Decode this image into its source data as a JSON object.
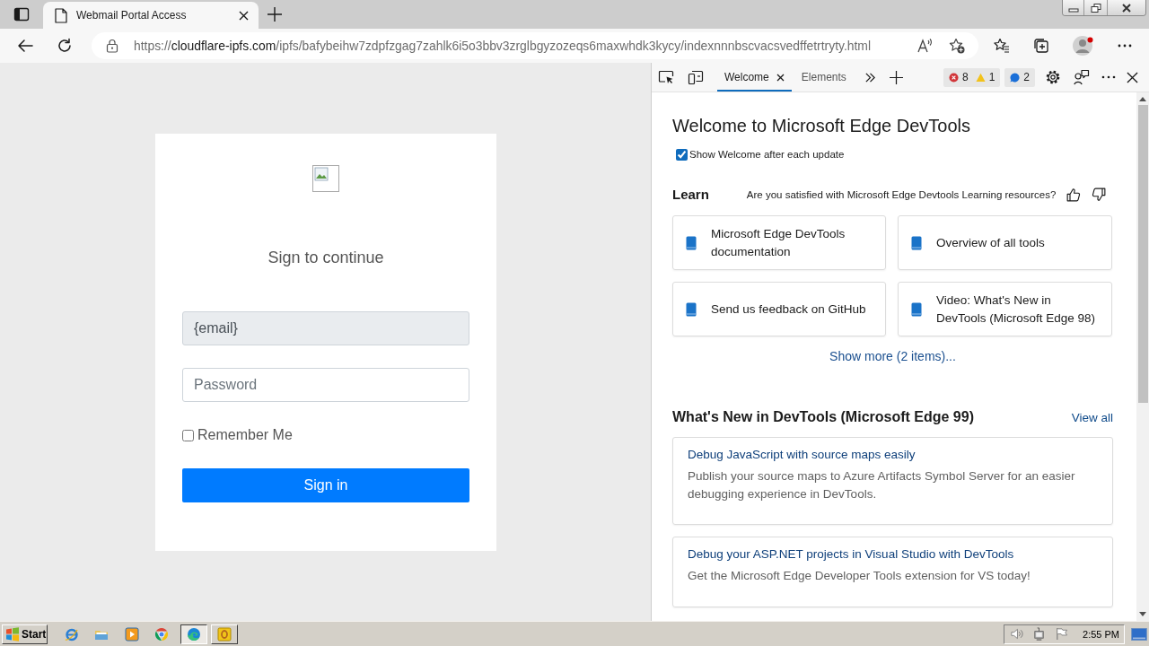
{
  "browser": {
    "tabs": [
      {
        "title": "Webmail Portal Access",
        "selected": true
      }
    ],
    "address_bar": {
      "scheme": "https://",
      "host": "cloudflare-ipfs.com",
      "path": "/ipfs/bafybeihw7zdpfzgag7zahlk6i5o3bbv3zrglbgyzozeqs6maxwhdk3kycy/indexnnnbscvacsvedffetrtryty.html"
    }
  },
  "login": {
    "heading": "Sign to continue",
    "email": {
      "value": "{email}",
      "readonly": true
    },
    "password": {
      "placeholder": "Password"
    },
    "remember_me": {
      "label": "Remember Me",
      "checked": false
    },
    "submit": "Sign in"
  },
  "devtools": {
    "tabs": [
      {
        "label": "Welcome",
        "selected": true,
        "closable": true
      },
      {
        "label": "Elements",
        "selected": false,
        "closable": false
      }
    ],
    "issues": {
      "errors": "8",
      "warnings": "1",
      "messages": "2"
    },
    "welcome": {
      "title": "Welcome to Microsoft Edge DevTools",
      "show_welcome": {
        "label": "Show Welcome after each update",
        "checked": true
      },
      "learn": {
        "heading": "Learn",
        "feedback_question": "Are you satisfied with Microsoft Edge Devtools Learning resources?",
        "links": [
          "Microsoft Edge DevTools documentation",
          "Overview of all tools",
          "Send us feedback on GitHub",
          "Video: What's New in DevTools (Microsoft Edge 98)"
        ],
        "show_more": "Show more (2 items)..."
      },
      "whats_new": {
        "heading": "What's New in DevTools (Microsoft Edge 99)",
        "view_all": "View all",
        "items": [
          {
            "title": "Debug JavaScript with source maps easily",
            "description": "Publish your source maps to Azure Artifacts Symbol Server for an easier debugging experience in DevTools."
          },
          {
            "title": "Debug your ASP.NET projects in Visual Studio with DevTools",
            "description": "Get the Microsoft Edge Developer Tools extension for VS today!"
          }
        ]
      }
    }
  },
  "taskbar": {
    "start": "Start",
    "quick_launch": [
      {
        "kind": "ie"
      },
      {
        "kind": "explorer"
      },
      {
        "kind": "media"
      },
      {
        "kind": "chrome"
      }
    ],
    "windows": [
      {
        "kind": "edge",
        "selected": true
      },
      {
        "kind": "app",
        "selected": false
      }
    ],
    "clock": "2:55 PM"
  }
}
